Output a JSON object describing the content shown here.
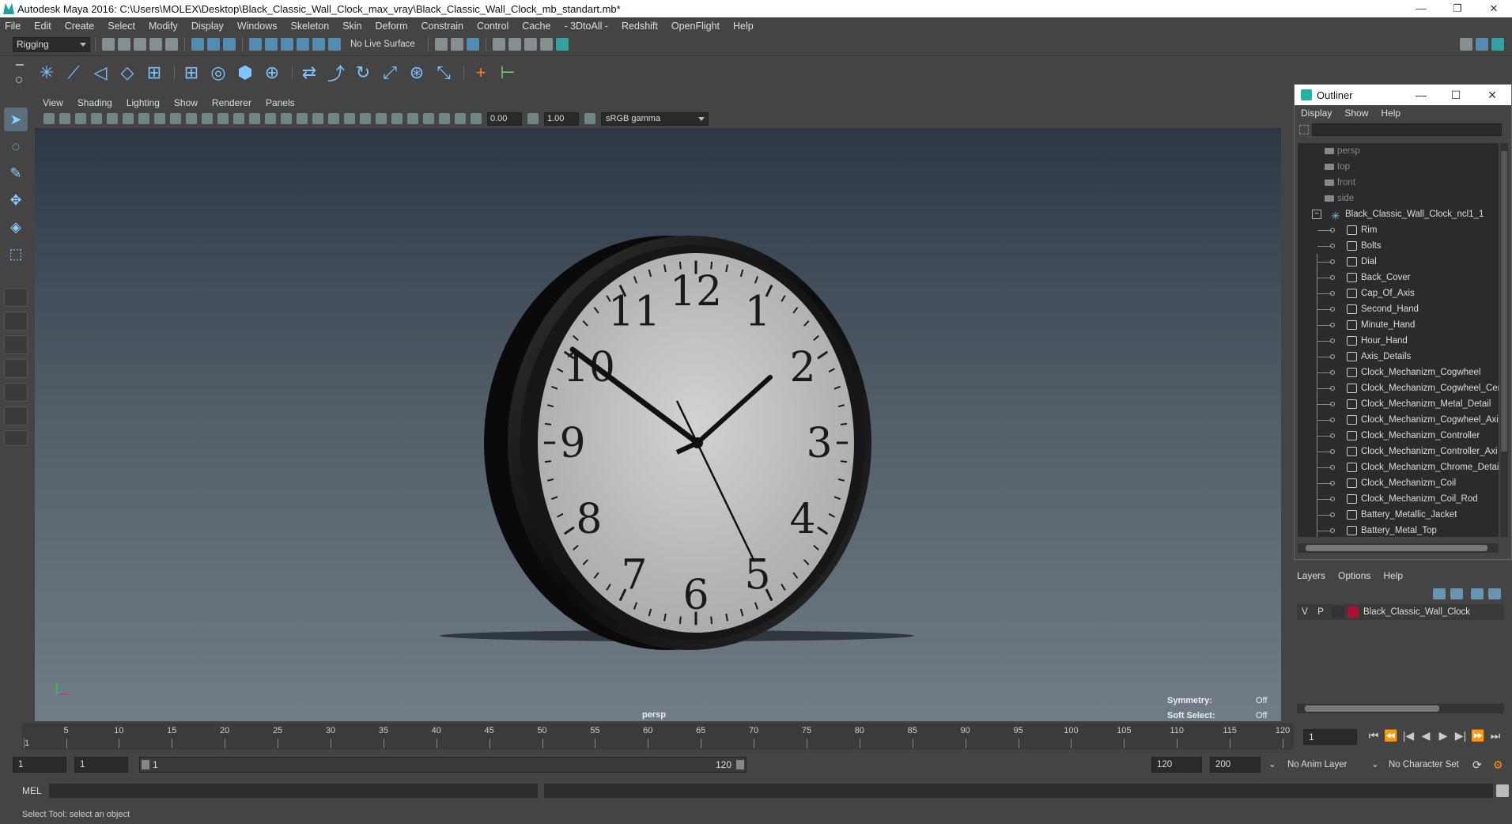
{
  "window": {
    "title": "Autodesk Maya 2016: C:\\Users\\MOLEX\\Desktop\\Black_Classic_Wall_Clock_max_vray\\Black_Classic_Wall_Clock_mb_standart.mb*",
    "minimize": "—",
    "restore": "❐",
    "close": "✕"
  },
  "menubar": [
    "File",
    "Edit",
    "Create",
    "Select",
    "Modify",
    "Display",
    "Windows",
    "Skeleton",
    "Skin",
    "Deform",
    "Constrain",
    "Control",
    "Cache",
    "- 3DtoAll -",
    "Redshift",
    "OpenFlight",
    "Help"
  ],
  "statusline": {
    "menuset": "Rigging",
    "live_surface": "No Live Surface"
  },
  "panel": {
    "menu": [
      "View",
      "Shading",
      "Lighting",
      "Show",
      "Renderer",
      "Panels"
    ],
    "exposure": "0.00",
    "gamma": "1.00",
    "colorspace": "sRGB gamma",
    "camera": "persp",
    "symmetry_label": "Symmetry:",
    "symmetry_value": "Off",
    "soft_select_label": "Soft Select:",
    "soft_select_value": "Off"
  },
  "clock": {
    "numerals": [
      "12",
      "1",
      "2",
      "3",
      "4",
      "5",
      "6",
      "7",
      "8",
      "9",
      "10",
      "11"
    ]
  },
  "outliner": {
    "title": "Outliner",
    "menu": [
      "Display",
      "Show",
      "Help"
    ],
    "cameras": [
      "persp",
      "top",
      "front",
      "side"
    ],
    "group": "Black_Classic_Wall_Clock_ncl1_1",
    "expander": "−",
    "children": [
      "Rim",
      "Bolts",
      "Dial",
      "Back_Cover",
      "Cap_Of_Axis",
      "Second_Hand",
      "Minute_Hand",
      "Hour_Hand",
      "Axis_Details",
      "Clock_Mechanizm_Cogwheel",
      "Clock_Mechanizm_Cogwheel_Cer",
      "Clock_Mechanizm_Metal_Detail",
      "Clock_Mechanizm_Cogwheel_Axi",
      "Clock_Mechanizm_Controller",
      "Clock_Mechanizm_Controller_Axi",
      "Clock_Mechanizm_Chrome_Detail",
      "Clock_Mechanizm_Coil",
      "Clock_Mechanizm_Coil_Rod",
      "Battery_Metallic_Jacket",
      "Battery_Metal_Top"
    ]
  },
  "layers": {
    "menu": [
      "Layers",
      "Options",
      "Help"
    ],
    "row": {
      "v": "V",
      "p": "P",
      "name": "Black_Classic_Wall_Clock",
      "color": "#b01030"
    }
  },
  "timeline": {
    "ticks": [
      1,
      5,
      10,
      15,
      20,
      25,
      30,
      35,
      40,
      45,
      50,
      55,
      60,
      65,
      70,
      75,
      80,
      85,
      90,
      95,
      100,
      105,
      110,
      115,
      120
    ],
    "current_frame": "1",
    "controls": [
      "⏮",
      "⏪",
      "|◀",
      "◀",
      "▶",
      "▶|",
      "⏩",
      "⏭"
    ]
  },
  "range": {
    "start_frame": "1",
    "playback_start": "1",
    "range_start": "1",
    "range_end": "120",
    "playback_end": "120",
    "end_frame": "200",
    "anim_layer": "No Anim Layer",
    "character_set": "No Character Set"
  },
  "cmdline": {
    "label": "MEL"
  },
  "helpline": {
    "text": "Select Tool: select an object"
  }
}
